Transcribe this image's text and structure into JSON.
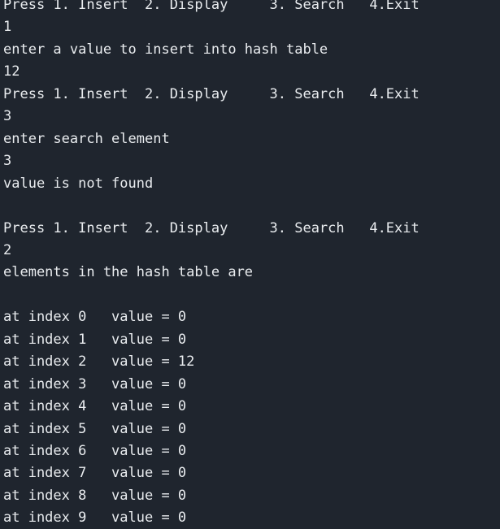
{
  "terminal": {
    "lines": [
      "Press 1. Insert  2. Display     3. Search   4.Exit",
      "1",
      "enter a value to insert into hash table",
      "12",
      "Press 1. Insert  2. Display     3. Search   4.Exit",
      "3",
      "enter search element",
      "3",
      "value is not found",
      "",
      "Press 1. Insert  2. Display     3. Search   4.Exit",
      "2",
      "elements in the hash table are",
      "",
      "at index 0   value = 0",
      "at index 1   value = 0",
      "at index 2   value = 12",
      "at index 3   value = 0",
      "at index 4   value = 0",
      "at index 5   value = 0",
      "at index 6   value = 0",
      "at index 7   value = 0",
      "at index 8   value = 0",
      "at index 9   value = 0"
    ]
  },
  "colors": {
    "background": "#1f252e",
    "text": "#e9ecef"
  }
}
